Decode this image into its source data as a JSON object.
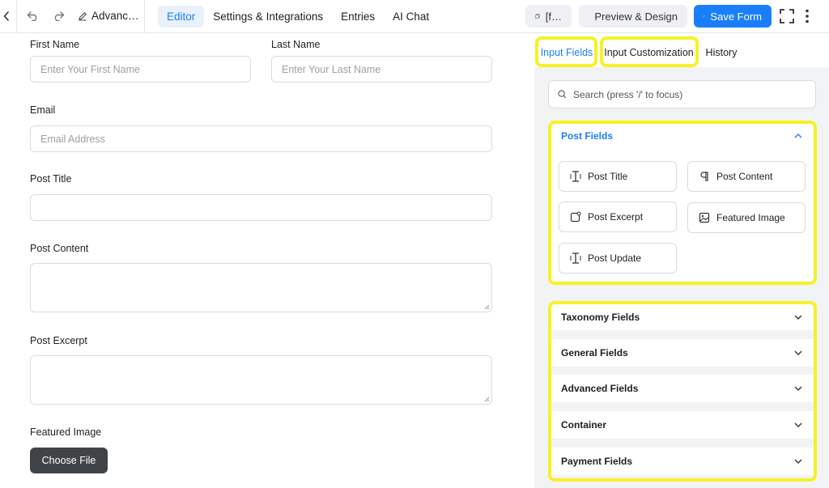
{
  "topbar": {
    "form_title": "Advanc…",
    "tabs": [
      {
        "label": "Editor",
        "active": true
      },
      {
        "label": "Settings & Integrations",
        "active": false
      },
      {
        "label": "Entries",
        "active": false
      },
      {
        "label": "AI Chat",
        "active": false
      }
    ],
    "shortcode_label": "[f…",
    "preview_label": "Preview & Design",
    "save_label": "Save Form",
    "accent": "#1a7efb"
  },
  "form": {
    "first_name": {
      "label": "First Name",
      "placeholder": "Enter Your First Name"
    },
    "last_name": {
      "label": "Last Name",
      "placeholder": "Enter Your Last Name"
    },
    "email": {
      "label": "Email",
      "placeholder": "Email Address"
    },
    "post_title": {
      "label": "Post Title",
      "placeholder": ""
    },
    "post_content": {
      "label": "Post Content"
    },
    "post_excerpt": {
      "label": "Post Excerpt"
    },
    "featured_image": {
      "label": "Featured Image",
      "button": "Choose File"
    }
  },
  "sidebar": {
    "tabs": [
      {
        "label": "Input Fields",
        "active": true
      },
      {
        "label": "Input Customization",
        "active": false
      },
      {
        "label": "History",
        "active": false
      }
    ],
    "search_placeholder": "Search (press '/' to focus)",
    "post_fields": {
      "title": "Post Fields",
      "expanded": true,
      "items": [
        {
          "label": "Post Title",
          "icon": "text-cursor-icon"
        },
        {
          "label": "Post Content",
          "icon": "paragraph-icon"
        },
        {
          "label": "Post Excerpt",
          "icon": "excerpt-icon"
        },
        {
          "label": "Featured Image",
          "icon": "image-icon"
        },
        {
          "label": "Post Update",
          "icon": "text-cursor-icon"
        }
      ]
    },
    "sections": [
      {
        "title": "Taxonomy Fields"
      },
      {
        "title": "General Fields"
      },
      {
        "title": "Advanced Fields"
      },
      {
        "title": "Container"
      },
      {
        "title": "Payment Fields"
      }
    ],
    "highlight_color": "#f5f227"
  }
}
